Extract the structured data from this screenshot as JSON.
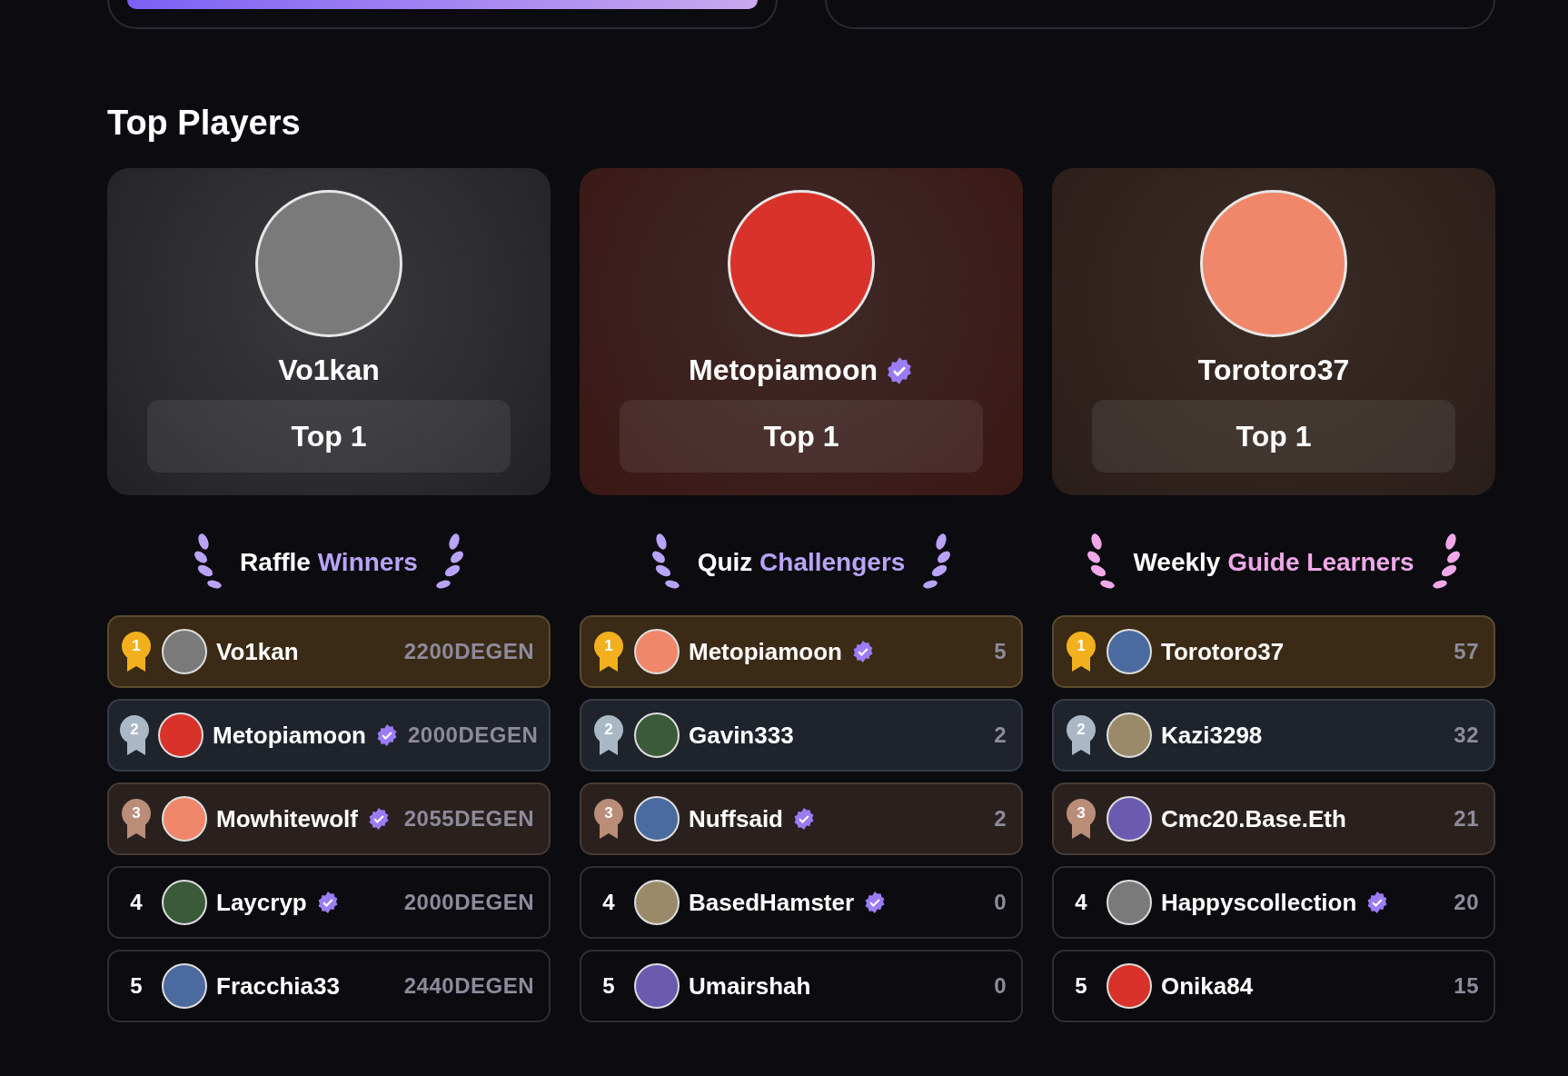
{
  "top_cards": [
    {
      "kind": "progress"
    },
    {
      "kind": "empty"
    }
  ],
  "section_title": "Top Players",
  "top_players": [
    {
      "name": "Vo1kan",
      "verified": false,
      "badge": "Top 1"
    },
    {
      "name": "Metopiamoon",
      "verified": true,
      "badge": "Top 1"
    },
    {
      "name": "Torotoro37",
      "verified": false,
      "badge": "Top 1"
    }
  ],
  "leaderboards": [
    {
      "title_lead": "Raffle",
      "title_accent": "Winners",
      "color": "#b9a3f7",
      "rows": [
        {
          "kind": "gold",
          "rank": "1",
          "name": "Vo1kan",
          "verified": false,
          "score": "2200DEGEN"
        },
        {
          "kind": "silver",
          "rank": "2",
          "name": "Metopiamoon",
          "verified": true,
          "score": "2000DEGEN"
        },
        {
          "kind": "bronze",
          "rank": "3",
          "name": "Mowhitewolf",
          "verified": true,
          "score": "2055DEGEN"
        },
        {
          "kind": "plain",
          "rank": "4",
          "name": "Laycryp",
          "verified": true,
          "score": "2000DEGEN"
        },
        {
          "kind": "plain",
          "rank": "5",
          "name": "Fracchia33",
          "verified": false,
          "score": "2440DEGEN"
        }
      ]
    },
    {
      "title_lead": "Quiz",
      "title_accent": "Challengers",
      "color": "#b9a3f7",
      "rows": [
        {
          "kind": "gold",
          "rank": "1",
          "name": "Metopiamoon",
          "verified": true,
          "score": "5"
        },
        {
          "kind": "silver",
          "rank": "2",
          "name": "Gavin333",
          "verified": false,
          "score": "2"
        },
        {
          "kind": "bronze",
          "rank": "3",
          "name": "Nuffsaid",
          "verified": true,
          "score": "2"
        },
        {
          "kind": "plain",
          "rank": "4",
          "name": "BasedHamster",
          "verified": true,
          "score": "0"
        },
        {
          "kind": "plain",
          "rank": "5",
          "name": "Umairshah",
          "verified": false,
          "score": "0"
        }
      ]
    },
    {
      "title_lead": "Weekly",
      "title_accent": "Guide Learners",
      "color": "#f0a8e8",
      "rows": [
        {
          "kind": "gold",
          "rank": "1",
          "name": "Torotoro37",
          "verified": false,
          "score": "57"
        },
        {
          "kind": "silver",
          "rank": "2",
          "name": "Kazi3298",
          "verified": false,
          "score": "32"
        },
        {
          "kind": "bronze",
          "rank": "3",
          "name": "Cmc20.Base.Eth",
          "verified": false,
          "score": "21"
        },
        {
          "kind": "plain",
          "rank": "4",
          "name": "Happyscollection",
          "verified": true,
          "score": "20"
        },
        {
          "kind": "plain",
          "rank": "5",
          "name": "Onika84",
          "verified": false,
          "score": "15"
        }
      ]
    }
  ]
}
